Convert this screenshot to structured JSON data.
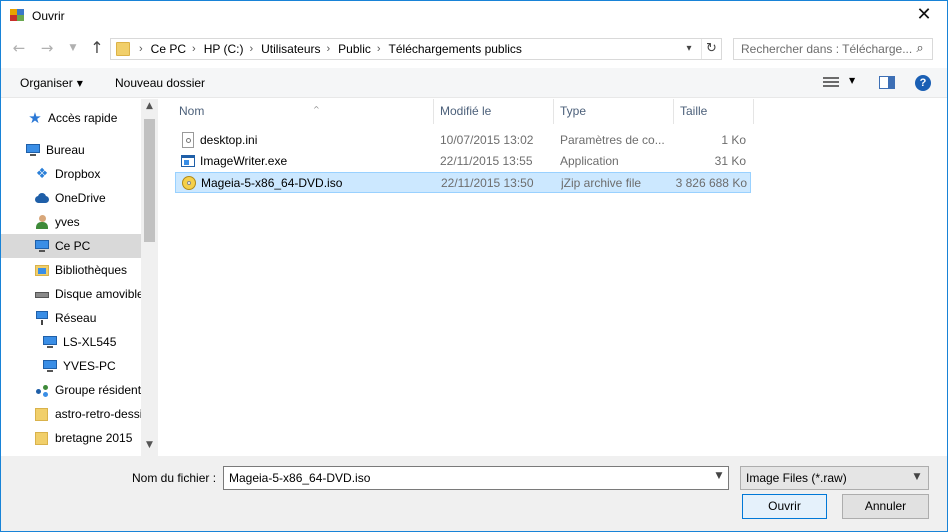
{
  "window": {
    "title": "Ouvrir",
    "close_glyph": "✕"
  },
  "address": {
    "crumbs": [
      "Ce PC",
      "HP (C:)",
      "Utilisateurs",
      "Public",
      "Téléchargements publics"
    ],
    "separator": "›"
  },
  "search": {
    "placeholder": "Rechercher dans : Télécharge..."
  },
  "toolbar": {
    "organize_label": "Organiser",
    "new_folder_label": "Nouveau dossier",
    "help_label": "?"
  },
  "nav": {
    "items": [
      {
        "label": "Accès rapide",
        "icon": "star-icon"
      },
      {
        "label": "Bureau",
        "icon": "desktop-icon"
      },
      {
        "label": "Dropbox",
        "icon": "dropbox-icon"
      },
      {
        "label": "OneDrive",
        "icon": "cloud-icon"
      },
      {
        "label": "yves",
        "icon": "user-icon"
      },
      {
        "label": "Ce PC",
        "icon": "computer-icon",
        "selected": true
      },
      {
        "label": "Bibliothèques",
        "icon": "library-icon"
      },
      {
        "label": "Disque amovible",
        "icon": "drive-icon"
      },
      {
        "label": "Réseau",
        "icon": "network-icon"
      },
      {
        "label": "LS-XL545",
        "icon": "computer-icon"
      },
      {
        "label": "YVES-PC",
        "icon": "computer-icon"
      },
      {
        "label": "Groupe résidentiel",
        "icon": "homegroup-icon"
      },
      {
        "label": "astro-retro-dessins",
        "icon": "folder-icon"
      },
      {
        "label": "bretagne 2015",
        "icon": "folder-icon"
      }
    ]
  },
  "columns": {
    "name": "Nom",
    "date": "Modifié le",
    "type": "Type",
    "size": "Taille"
  },
  "files": [
    {
      "name": "desktop.ini",
      "date": "10/07/2015 13:02",
      "type": "Paramètres de co...",
      "size": "1 Ko",
      "icon": "settings-file-icon"
    },
    {
      "name": "ImageWriter.exe",
      "date": "22/11/2015 13:55",
      "type": "Application",
      "size": "31 Ko",
      "icon": "application-icon"
    },
    {
      "name": "Mageia-5-x86_64-DVD.iso",
      "date": "22/11/2015 13:50",
      "type": "jZip archive file",
      "size": "3 826 688 Ko",
      "icon": "disc-image-icon",
      "selected": true
    }
  ],
  "bottom": {
    "filename_label": "Nom du fichier :",
    "filename_value": "Mageia-5-x86_64-DVD.iso",
    "filter_value": "Image Files (*.raw)",
    "open_label": "Ouvrir",
    "cancel_label": "Annuler"
  },
  "colors": {
    "accent": "#0078d7",
    "selection": "#cce8ff",
    "selection_border": "#99d1ff"
  }
}
